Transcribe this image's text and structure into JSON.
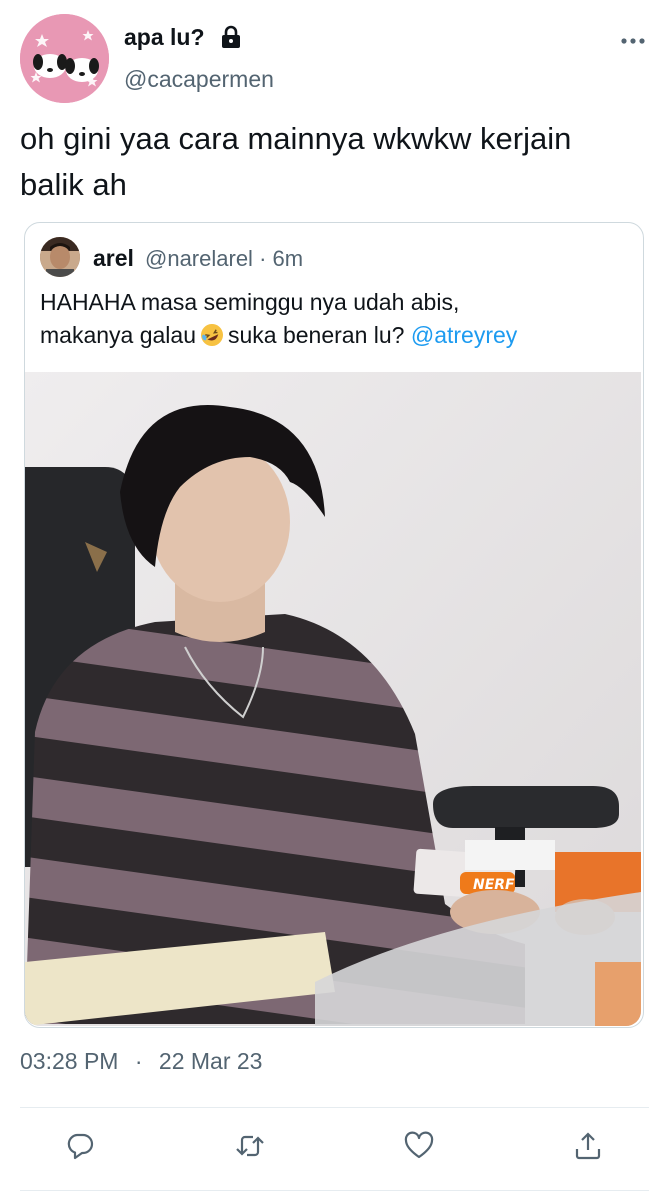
{
  "author": {
    "display_name": "apa lu?",
    "handle": "@cacapermen",
    "avatar_icon": "cartoon-dogs-avatar",
    "protected_icon": "lock-icon"
  },
  "tweet": {
    "text": "oh gini yaa cara mainnya wkwkw kerjain balik ah",
    "timestamp_time": "03:28 PM",
    "timestamp_sep": "·",
    "timestamp_date": "22 Mar 23"
  },
  "quoted": {
    "name": "arel",
    "handle": "@narelarel",
    "sep": "·",
    "age": "6m",
    "text_line1": "HAHAHA masa seminggu nya udah abis,",
    "text_line2_a": "makanya galau",
    "text_line2_b": "suka beneran lu?",
    "mention": "@atreyrey",
    "emoji": "rolling-on-floor-laughing"
  },
  "actions": [
    "reply",
    "retweet",
    "like",
    "share"
  ],
  "colors": {
    "text": "#0f1419",
    "secondary": "#536471",
    "link": "#1d9bf0",
    "border": "#cfd9de",
    "avatar_bg": "#e898b4"
  }
}
